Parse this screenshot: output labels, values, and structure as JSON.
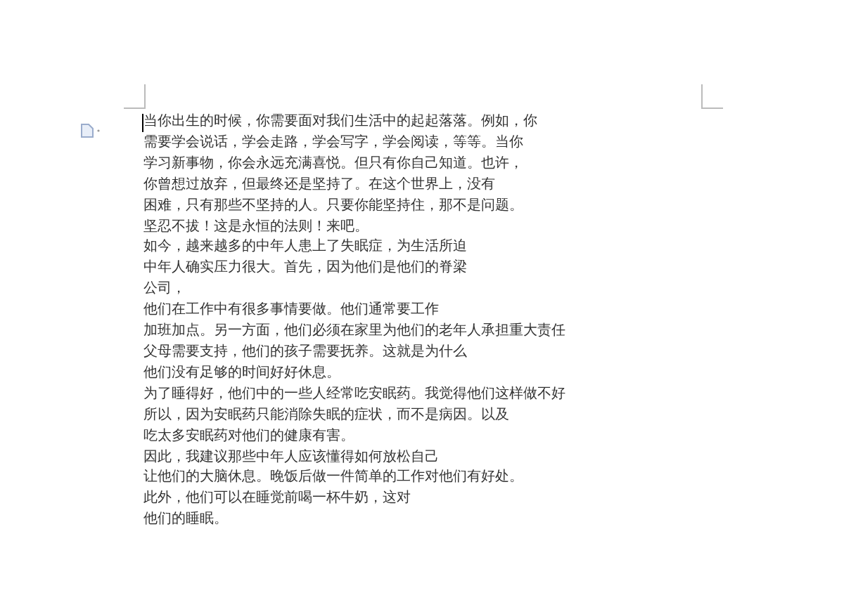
{
  "document": {
    "lines": [
      "当你出生的时候，你需要面对我们生活中的起起落落。例如，你",
      "需要学会说话，学会走路，学会写字，学会阅读，等等。当你",
      "学习新事物，你会永远充满喜悦。但只有你自己知道。也许，",
      "你曾想过放弃，但最终还是坚持了。在这个世界上，没有",
      "困难，只有那些不坚持的人。只要你能坚持住，那不是问题。",
      "坚忍不拔！这是永恒的法则！来吧。",
      "如今，越来越多的中年人患上了失眠症，为生活所迫",
      "中年人确实压力很大。首先，因为他们是他们的脊梁",
      "公司，",
      "他们在工作中有很多事情要做。他们通常要工作",
      "加班加点。另一方面，他们必须在家里为他们的老年人承担重大责任",
      "父母需要支持，他们的孩子需要抚养。这就是为什么",
      "他们没有足够的时间好好休息。",
      "为了睡得好，他们中的一些人经常吃安眠药。我觉得他们这样做不好",
      "所以，因为安眠药只能消除失眠的症状，而不是病因。以及",
      "吃太多安眠药对他们的健康有害。",
      "因此，我建议那些中年人应该懂得如何放松自己",
      "让他们的大脑休息。晚饭后做一件简单的工作对他们有好处。",
      "此外，他们可以在睡觉前喝一杯牛奶，这对",
      "他们的睡眠。"
    ]
  }
}
